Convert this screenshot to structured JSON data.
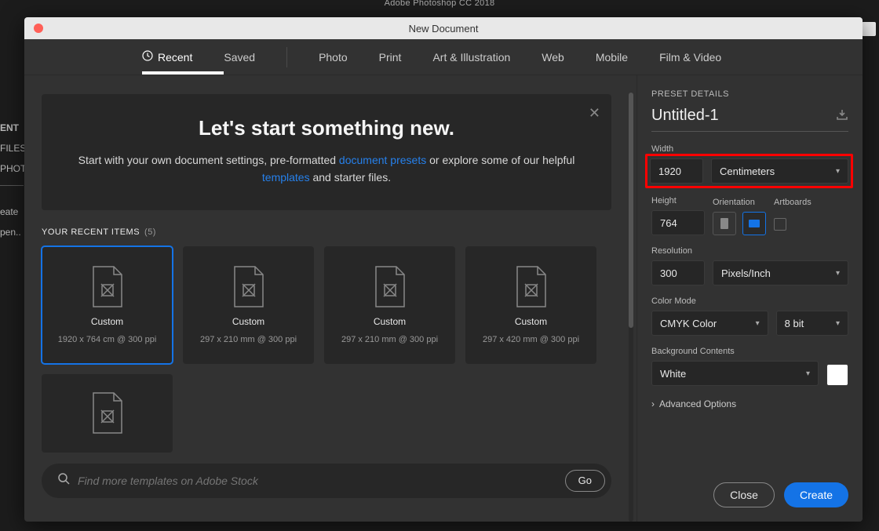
{
  "app": {
    "title": "Adobe Photoshop CC 2018"
  },
  "bg_sidebar": [
    "ENT",
    "FILES",
    "PHOT",
    "eate",
    "pen.."
  ],
  "dialog": {
    "title": "New Document",
    "tabs": [
      "Recent",
      "Saved",
      "Photo",
      "Print",
      "Art & Illustration",
      "Web",
      "Mobile",
      "Film & Video"
    ],
    "hero": {
      "heading": "Let's start something new.",
      "line1a": "Start with your own document settings, pre-formatted ",
      "link1": "document presets",
      "line1b": " or explore some of our helpful ",
      "link2": "templates",
      "line1c": " and starter files."
    },
    "recent_label": "YOUR RECENT ITEMS",
    "recent_count": "(5)",
    "cards": [
      {
        "title": "Custom",
        "sub": "1920 x 764 cm @ 300 ppi"
      },
      {
        "title": "Custom",
        "sub": "297 x 210 mm @ 300 ppi"
      },
      {
        "title": "Custom",
        "sub": "297 x 210 mm @ 300 ppi"
      },
      {
        "title": "Custom",
        "sub": "297 x 420 mm @ 300 ppi"
      }
    ],
    "search_placeholder": "Find more templates on Adobe Stock",
    "go": "Go"
  },
  "panel": {
    "heading": "PRESET DETAILS",
    "name": "Untitled-1",
    "width_label": "Width",
    "width": "1920",
    "units": "Centimeters",
    "height_label": "Height",
    "height": "764",
    "orientation_label": "Orientation",
    "artboards_label": "Artboards",
    "resolution_label": "Resolution",
    "resolution": "300",
    "res_units": "Pixels/Inch",
    "colormode_label": "Color Mode",
    "colormode": "CMYK Color",
    "bitdepth": "8 bit",
    "bg_label": "Background Contents",
    "bg": "White",
    "advanced": "Advanced Options",
    "close": "Close",
    "create": "Create"
  }
}
